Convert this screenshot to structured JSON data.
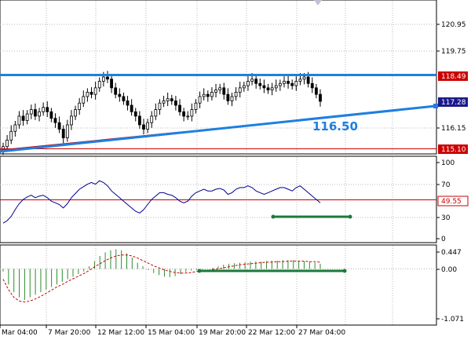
{
  "price_panel": {
    "axis_labels": [
      "120.95",
      "119.75",
      "117.28",
      "116.15"
    ],
    "price_tags": [
      {
        "value": "118.49",
        "color": "#cc0000"
      },
      {
        "value": "117.28",
        "color": "#1a1a8a"
      },
      {
        "value": "115.10",
        "color": "#cc0000"
      }
    ],
    "annotation": "116.50",
    "colors": {
      "trendline": "#1e7fe0",
      "resistance": "#1e7fe0",
      "support": "#cc0000",
      "candles": "#000000"
    }
  },
  "rsi_panel": {
    "axis_labels": [
      "100",
      "70",
      "30",
      "0"
    ],
    "level_tag": {
      "value": "49.55",
      "color": "#cc0000"
    },
    "colors": {
      "line": "#00008b",
      "level": "#cc0000",
      "marker": "#1a7a3a"
    }
  },
  "macd_panel": {
    "axis_labels": [
      "0.447",
      "0.00",
      "-1.071"
    ],
    "colors": {
      "histogram": "#2e8b2e",
      "signal": "#cc0000",
      "marker": "#1a7a3a"
    }
  },
  "time_axis": {
    "labels": [
      "Mar 04:00",
      "7 Mar 20:00",
      "12 Mar 12:00",
      "15 Mar 04:00",
      "19 Mar 20:00",
      "22 Mar 12:00",
      "27 Mar 04:00"
    ]
  },
  "chart_data": [
    {
      "type": "candlestick",
      "title": "",
      "ylim": [
        114.9,
        121.9
      ],
      "close": [
        115.2,
        115.5,
        115.9,
        116.2,
        116.6,
        116.4,
        116.7,
        116.9,
        116.6,
        116.8,
        117.0,
        116.8,
        116.5,
        116.3,
        116.0,
        115.6,
        116.2,
        116.6,
        116.9,
        117.2,
        117.5,
        117.7,
        117.6,
        117.9,
        118.2,
        118.4,
        118.3,
        117.9,
        117.6,
        117.5,
        117.3,
        117.1,
        116.8,
        116.6,
        116.2,
        116.0,
        116.3,
        116.6,
        116.9,
        117.2,
        117.3,
        117.4,
        117.3,
        117.1,
        116.8,
        116.6,
        116.6,
        116.9,
        117.2,
        117.5,
        117.6,
        117.5,
        117.7,
        117.8,
        117.9,
        117.6,
        117.3,
        117.5,
        117.7,
        117.9,
        118.0,
        118.2,
        118.3,
        118.1,
        118.0,
        117.9,
        117.8,
        117.9,
        118.0,
        118.1,
        118.2,
        118.1,
        118.0,
        118.2,
        118.3,
        118.4,
        118.1,
        117.9,
        117.6,
        117.28
      ],
      "resistance": 118.49,
      "support": 115.1,
      "last_price": 117.28,
      "trendline_label": 116.5
    },
    {
      "type": "line",
      "title": "",
      "ylim": [
        0,
        100
      ],
      "levels": [
        49.55
      ],
      "values": [
        22,
        25,
        30,
        38,
        45,
        50,
        53,
        55,
        52,
        54,
        55,
        52,
        48,
        46,
        44,
        40,
        45,
        52,
        57,
        62,
        65,
        68,
        70,
        68,
        72,
        70,
        66,
        60,
        56,
        52,
        48,
        44,
        40,
        36,
        34,
        38,
        44,
        50,
        54,
        58,
        58,
        56,
        55,
        52,
        48,
        46,
        48,
        54,
        58,
        60,
        62,
        60,
        60,
        62,
        63,
        61,
        56,
        58,
        62,
        64,
        64,
        66,
        64,
        60,
        58,
        56,
        58,
        60,
        62,
        64,
        64,
        62,
        60,
        64,
        66,
        62,
        58,
        54,
        50,
        46
      ]
    },
    {
      "type": "bar",
      "title": "",
      "ylim": [
        -1.071,
        0.447
      ],
      "levels": [
        0
      ],
      "values": [
        -0.05,
        -0.3,
        -0.45,
        -0.55,
        -0.6,
        -0.55,
        -0.5,
        -0.45,
        -0.4,
        -0.35,
        -0.3,
        -0.25,
        -0.2,
        -0.15,
        -0.1,
        -0.05,
        0.05,
        0.15,
        0.25,
        0.32,
        0.36,
        0.38,
        0.36,
        0.3,
        0.22,
        0.12,
        0.05,
        -0.02,
        -0.08,
        -0.12,
        -0.15,
        -0.16,
        -0.14,
        -0.1,
        -0.06,
        -0.03,
        -0.02,
        -0.01,
        0.0,
        0.02,
        0.05,
        0.08,
        0.1,
        0.11,
        0.12,
        0.13,
        0.14,
        0.14,
        0.14,
        0.15,
        0.16,
        0.16,
        0.17,
        0.17,
        0.17,
        0.16,
        0.15,
        0.14,
        0.12,
        0.1
      ],
      "signal": [
        -0.2,
        -0.4,
        -0.55,
        -0.62,
        -0.64,
        -0.62,
        -0.58,
        -0.53,
        -0.47,
        -0.41,
        -0.35,
        -0.3,
        -0.24,
        -0.19,
        -0.14,
        -0.09,
        -0.03,
        0.04,
        0.1,
        0.16,
        0.21,
        0.25,
        0.27,
        0.27,
        0.25,
        0.21,
        0.16,
        0.11,
        0.06,
        0.02,
        -0.02,
        -0.05,
        -0.07,
        -0.08,
        -0.08,
        -0.07,
        -0.05,
        -0.04,
        -0.03,
        -0.01,
        0.0,
        0.02,
        0.04,
        0.06,
        0.08,
        0.09,
        0.1,
        0.11,
        0.12,
        0.13,
        0.13,
        0.14,
        0.14,
        0.15,
        0.15,
        0.15,
        0.15,
        0.14,
        0.14,
        0.13
      ]
    }
  ]
}
